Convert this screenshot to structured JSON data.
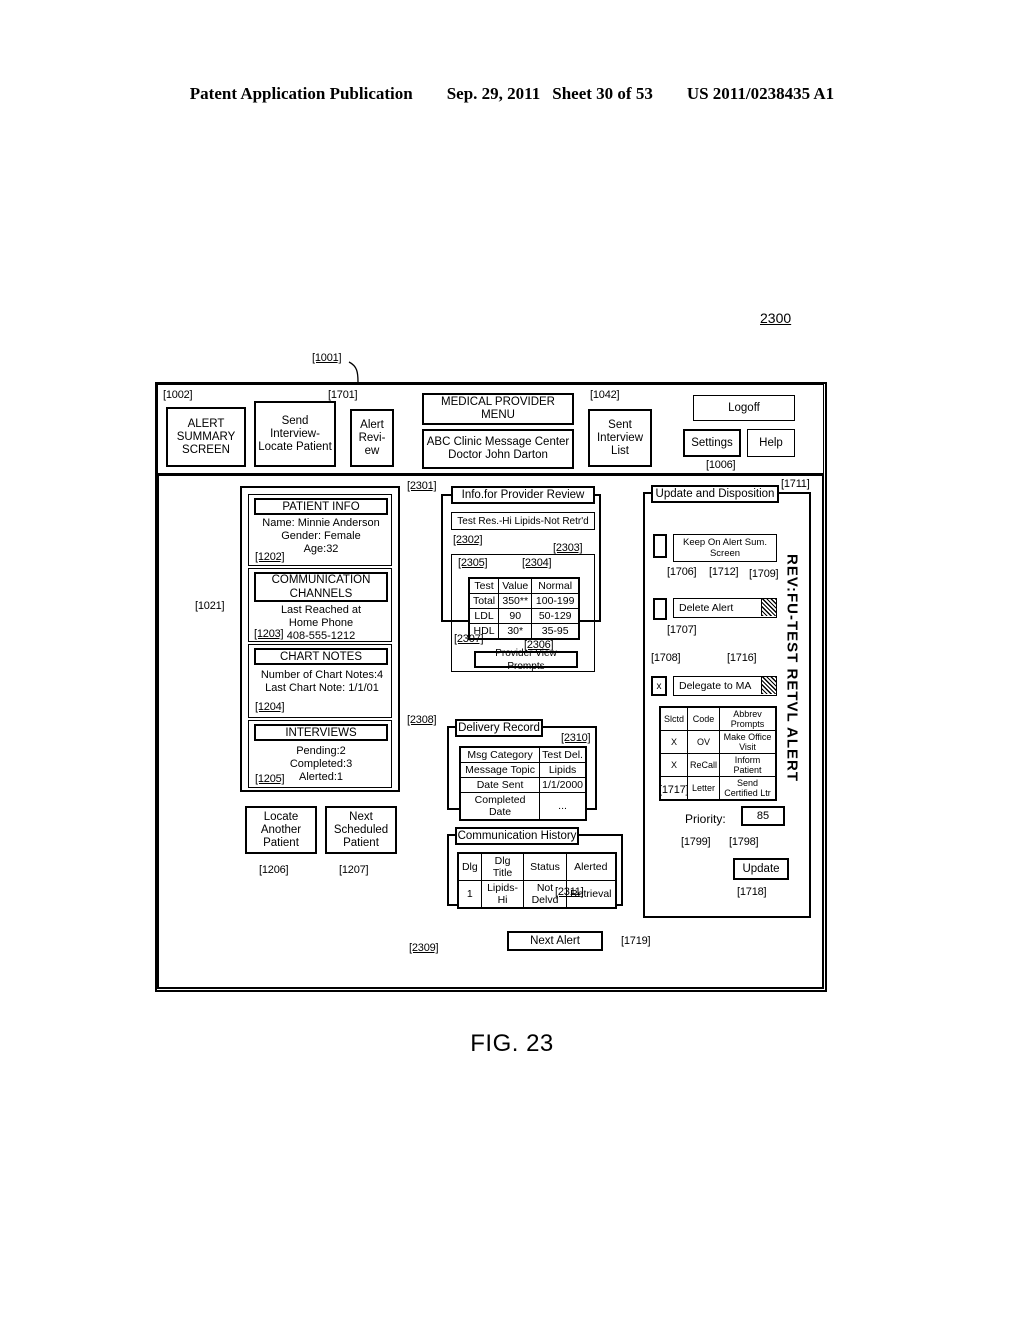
{
  "publication_header": {
    "left": "Patent Application Publication",
    "date": "Sep. 29, 2011",
    "sheet": "Sheet 30 of 53",
    "number": "US 2011/0238435 A1"
  },
  "figure": {
    "caption": "FIG. 23",
    "figure_ref": "2300",
    "screen_ref": "[1001]"
  },
  "toolbar": {
    "ref_alert_summary": "[1002]",
    "alert_summary_screen": "ALERT SUMMARY SCREEN",
    "send_interview_locate_patient": "Send Interview-Locate Patient",
    "ref_alert_review": "[1701]",
    "alert_review": "Alert Revi-ew",
    "medical_provider_menu": "MEDICAL PROVIDER MENU",
    "clinic_line": "ABC Clinic Message Center Doctor John Darton",
    "ref_sent_interview": "[1042]",
    "sent_interview_list": "Sent Interview List",
    "logoff": "Logoff",
    "settings": "Settings",
    "help": "Help",
    "ref_settings": "[1006]"
  },
  "left_panel": {
    "ref": "[1021]",
    "patient_info": {
      "title": "PATIENT INFO",
      "name": "Name: Minnie Anderson",
      "gender": "Gender: Female",
      "age": "Age:32",
      "ref": "[1202]"
    },
    "communication_channels": {
      "title": "COMMUNICATION CHANNELS",
      "line1": "Last Reached at",
      "line2": "Home Phone",
      "line3": "408-555-1212",
      "ref": "[1203]"
    },
    "chart_notes": {
      "title": "CHART NOTES",
      "line1": "Number of Chart Notes:4",
      "line2": "Last Chart Note: 1/1/01",
      "ref": "[1204]"
    },
    "interviews": {
      "title": "INTERVIEWS",
      "pending": "Pending:2",
      "completed": "Completed:3",
      "alerted": "Alerted:1",
      "ref": "[1205]"
    },
    "locate_another_patient": "Locate Another Patient",
    "ref_locate_another": "[1206]",
    "next_scheduled_patient": "Next Scheduled Patient",
    "ref_next_scheduled": "[1207]"
  },
  "center_panel": {
    "ref": "[2301]",
    "info_for_provider_review": "Info.for Provider Review",
    "alert_banner": "Test Res.-Hi Lipids-Not Retr'd",
    "ref_banner": "[2302]",
    "ref_banner_2": "[2303]",
    "ref_test_col": "[2305]",
    "ref_value_col": "[2304]",
    "ref_prompts": "[2307]",
    "ref_table": "[2306]",
    "provider_view_prompts": "Provider View Prompts",
    "lab_table": {
      "headers": [
        "Test",
        "Value",
        "Normal"
      ],
      "rows": [
        [
          "Total",
          "350**",
          "100-199"
        ],
        [
          "LDL",
          "90",
          "50-129"
        ],
        [
          "HDL",
          "30*",
          "35-95"
        ]
      ]
    },
    "delivery": {
      "ref": "[2308]",
      "title": "Delivery Record",
      "ref_value": "[2310]",
      "rows": [
        [
          "Msg Category",
          "Test Del."
        ],
        [
          "Message Topic",
          "Lipids"
        ],
        [
          "Date Sent",
          "1/1/2000"
        ],
        [
          "Completed Date",
          "..."
        ]
      ]
    },
    "history": {
      "ref": "[2309]",
      "title": "Communication History",
      "ref_row": "[2311]",
      "headers": [
        "Dlg",
        "Dlg Title",
        "Status",
        "Alerted"
      ],
      "rows": [
        [
          "1",
          "Lipids-Hi",
          "Not Delvd",
          "Retrieval"
        ]
      ]
    },
    "next_alert": "Next Alert",
    "ref_next_alert": "[1719]"
  },
  "right_panel": {
    "ref": "[1711]",
    "title": "Update and Disposition",
    "vertical_tab": "REV:FU-TEST RETVL ALERT",
    "keep_on_alert": "Keep On Alert Sum. Screen",
    "ref_keep_checkbox": "[1706]",
    "ref_keep_label": "[1712]",
    "ref_delete_scroll": "[1709]",
    "delete_alert": "Delete Alert",
    "ref_delete_checkbox": "[1707]",
    "ref_delegate_checkbox": "[1708]",
    "delegate_checkbox_value": "x",
    "ref_delegate_scroll": "[1716]",
    "delegate_to_ma": "Delegate to MA",
    "prompts_table": {
      "ref": "[1717]",
      "headers": [
        "Slctd",
        "Code",
        "Abbrev Prompts"
      ],
      "rows": [
        [
          "X",
          "OV",
          "Make Office Visit"
        ],
        [
          "X",
          "ReCall",
          "Inform Patient"
        ],
        [
          "",
          "Letter",
          "Send Certified Ltr"
        ]
      ]
    },
    "priority_label": "Priority:",
    "ref_priority_label": "[1799]",
    "priority_value": "85",
    "ref_priority_value": "[1798]",
    "update_button": "Update",
    "ref_update": "[1718]"
  }
}
